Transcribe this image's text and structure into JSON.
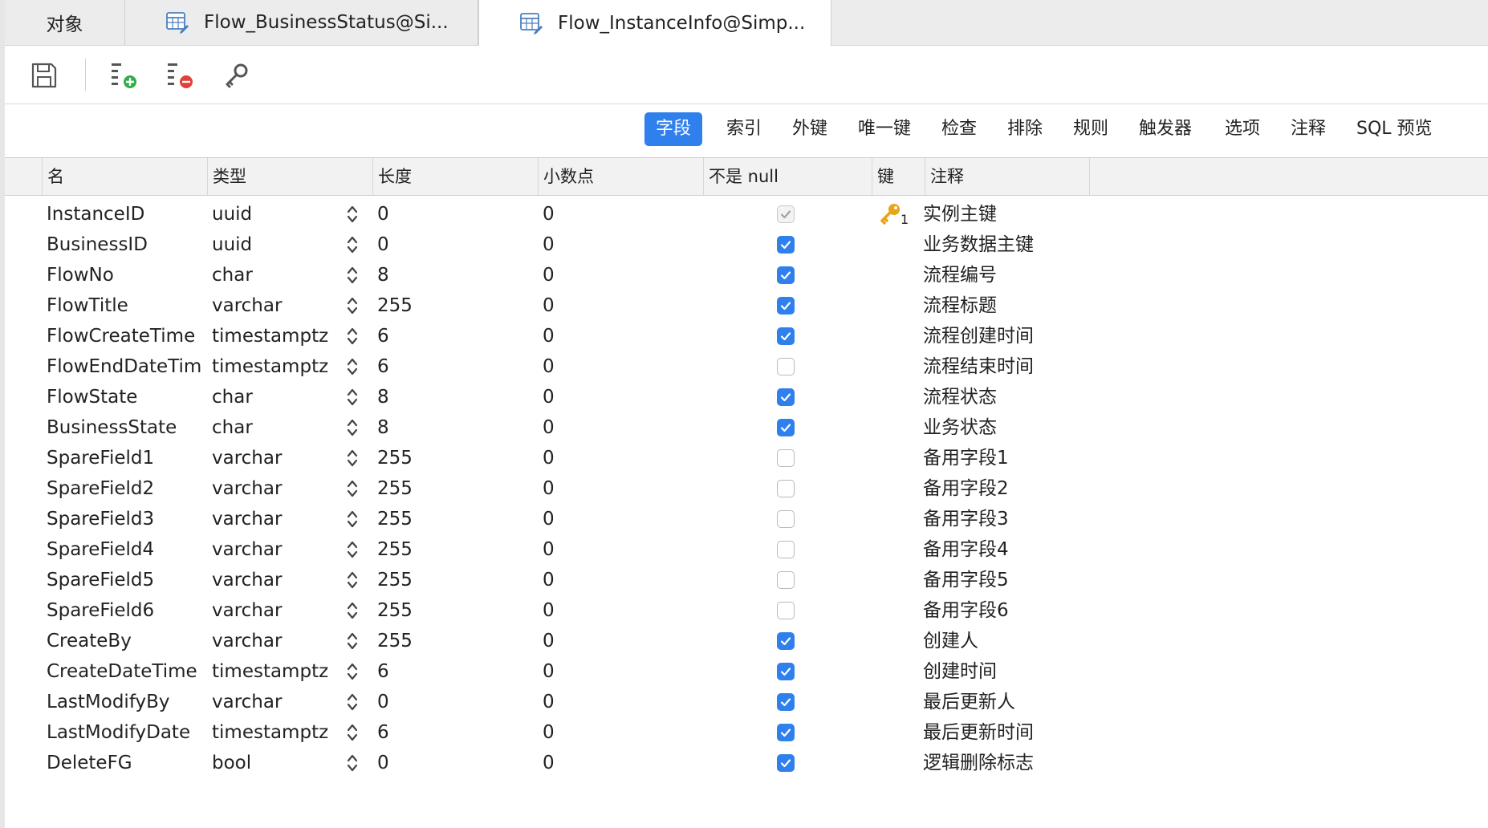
{
  "tabs": [
    {
      "label": "对象",
      "icon": "none"
    },
    {
      "label": "Flow_BusinessStatus@Si...",
      "icon": "table-edit-icon"
    },
    {
      "label": "Flow_InstanceInfo@Simp...",
      "icon": "table-edit-icon",
      "active": true
    }
  ],
  "toolbar": {
    "buttons": [
      "save-icon",
      "add-field-icon",
      "delete-field-icon",
      "primary-key-icon"
    ]
  },
  "subtabs": [
    "字段",
    "索引",
    "外键",
    "唯一键",
    "检查",
    "排除",
    "规则",
    "触发器",
    "选项",
    "注释",
    "SQL 预览"
  ],
  "active_subtab": "字段",
  "columns": [
    "名",
    "类型",
    "长度",
    "小数点",
    "不是 null",
    "键",
    "注释"
  ],
  "rows": [
    {
      "name": "InstanceID",
      "type": "uuid",
      "length": "0",
      "decimal": "0",
      "not_null": "dim",
      "key": "1",
      "comment": "实例主键"
    },
    {
      "name": "BusinessID",
      "type": "uuid",
      "length": "0",
      "decimal": "0",
      "not_null": "on",
      "key": "",
      "comment": "业务数据主键"
    },
    {
      "name": "FlowNo",
      "type": "char",
      "length": "8",
      "decimal": "0",
      "not_null": "on",
      "key": "",
      "comment": "流程编号"
    },
    {
      "name": "FlowTitle",
      "type": "varchar",
      "length": "255",
      "decimal": "0",
      "not_null": "on",
      "key": "",
      "comment": "流程标题"
    },
    {
      "name": "FlowCreateTime",
      "type": "timestamptz",
      "length": "6",
      "decimal": "0",
      "not_null": "on",
      "key": "",
      "comment": "流程创建时间"
    },
    {
      "name": "FlowEndDateTim",
      "type": "timestamptz",
      "length": "6",
      "decimal": "0",
      "not_null": "off",
      "key": "",
      "comment": "流程结束时间"
    },
    {
      "name": "FlowState",
      "type": "char",
      "length": "8",
      "decimal": "0",
      "not_null": "on",
      "key": "",
      "comment": "流程状态"
    },
    {
      "name": "BusinessState",
      "type": "char",
      "length": "8",
      "decimal": "0",
      "not_null": "on",
      "key": "",
      "comment": "业务状态"
    },
    {
      "name": "SpareField1",
      "type": "varchar",
      "length": "255",
      "decimal": "0",
      "not_null": "off",
      "key": "",
      "comment": "备用字段1"
    },
    {
      "name": "SpareField2",
      "type": "varchar",
      "length": "255",
      "decimal": "0",
      "not_null": "off",
      "key": "",
      "comment": "备用字段2"
    },
    {
      "name": "SpareField3",
      "type": "varchar",
      "length": "255",
      "decimal": "0",
      "not_null": "off",
      "key": "",
      "comment": "备用字段3"
    },
    {
      "name": "SpareField4",
      "type": "varchar",
      "length": "255",
      "decimal": "0",
      "not_null": "off",
      "key": "",
      "comment": "备用字段4"
    },
    {
      "name": "SpareField5",
      "type": "varchar",
      "length": "255",
      "decimal": "0",
      "not_null": "off",
      "key": "",
      "comment": "备用字段5"
    },
    {
      "name": "SpareField6",
      "type": "varchar",
      "length": "255",
      "decimal": "0",
      "not_null": "off",
      "key": "",
      "comment": "备用字段6"
    },
    {
      "name": "CreateBy",
      "type": "varchar",
      "length": "255",
      "decimal": "0",
      "not_null": "on",
      "key": "",
      "comment": "创建人"
    },
    {
      "name": "CreateDateTime",
      "type": "timestamptz",
      "length": "6",
      "decimal": "0",
      "not_null": "on",
      "key": "",
      "comment": "创建时间"
    },
    {
      "name": "LastModifyBy",
      "type": "varchar",
      "length": "0",
      "decimal": "0",
      "not_null": "on",
      "key": "",
      "comment": "最后更新人"
    },
    {
      "name": "LastModifyDate",
      "type": "timestamptz",
      "length": "6",
      "decimal": "0",
      "not_null": "on",
      "key": "",
      "comment": "最后更新时间"
    },
    {
      "name": "DeleteFG",
      "type": "bool",
      "length": "0",
      "decimal": "0",
      "not_null": "on",
      "key": "",
      "comment": "逻辑删除标志"
    }
  ],
  "colors": {
    "accent": "#2f80ed",
    "key_icon": "#e8a317"
  }
}
